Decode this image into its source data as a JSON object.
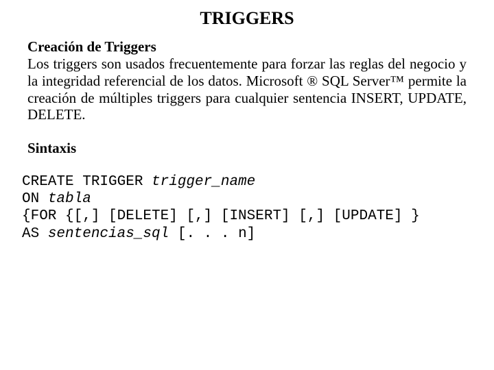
{
  "title": "TRIGGERS",
  "section1_heading": "Creación de Triggers",
  "section1_body": "Los triggers son usados frecuentemente para forzar las reglas del negocio y la integridad referencial de los datos. Microsoft ® SQL Server™ permite la creación de múltiples triggers para cualquier sentencia INSERT, UPDATE, DELETE.",
  "section2_heading": "Sintaxis",
  "code": {
    "line1_a": "CREATE TRIGGER ",
    "line1_b": "trigger_name",
    "line2_a": "ON ",
    "line2_b": "tabla",
    "line3": "{FOR {[,] [DELETE] [,] [INSERT] [,] [UPDATE] }",
    "line4_a": "AS ",
    "line4_b": "sentencias_sql",
    "line4_c": " [. . . n]"
  }
}
